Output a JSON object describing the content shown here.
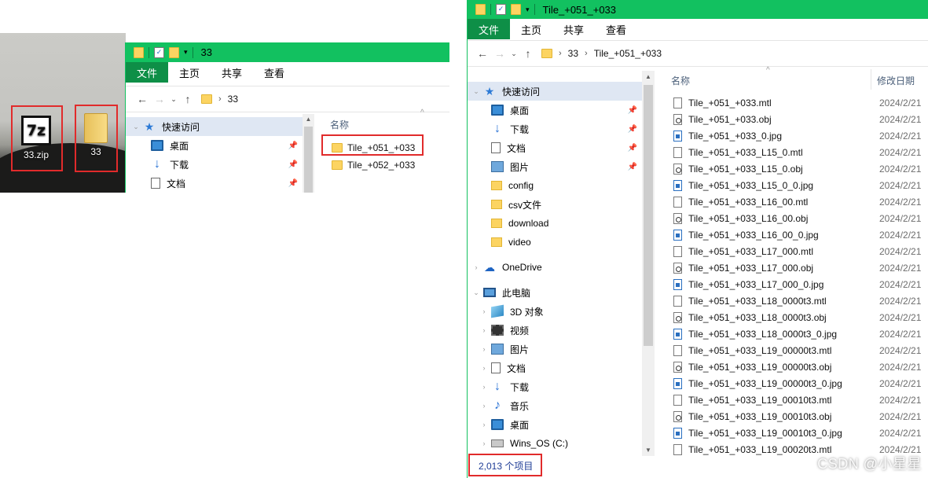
{
  "desktop": {
    "zip_label": "33.zip",
    "zip_icon_text": "7z",
    "folder_label": "33"
  },
  "win1": {
    "title": "33",
    "tabs": [
      "文件",
      "主页",
      "共享",
      "查看"
    ],
    "path": [
      "33"
    ],
    "nav": [
      {
        "label": "快速访问",
        "icon": "star-icon"
      },
      {
        "label": "桌面",
        "icon": "desktop-icon"
      },
      {
        "label": "下载",
        "icon": "download-icon"
      },
      {
        "label": "文档",
        "icon": "document-icon"
      }
    ],
    "column_name": "名称",
    "folders": [
      "Tile_+051_+033",
      "Tile_+052_+033"
    ]
  },
  "win2": {
    "title": "Tile_+051_+033",
    "tabs": [
      "文件",
      "主页",
      "共享",
      "查看"
    ],
    "path": [
      "33",
      "Tile_+051_+033"
    ],
    "nav": [
      {
        "label": "快速访问",
        "icon": "star-icon",
        "pinned": false
      },
      {
        "label": "桌面",
        "icon": "desktop-icon",
        "pinned": true
      },
      {
        "label": "下载",
        "icon": "download-icon",
        "pinned": true
      },
      {
        "label": "文档",
        "icon": "document-icon",
        "pinned": true
      },
      {
        "label": "图片",
        "icon": "picture-icon",
        "pinned": true
      },
      {
        "label": "config",
        "icon": "folder-icon",
        "pinned": false
      },
      {
        "label": "csv文件",
        "icon": "folder-icon",
        "pinned": false
      },
      {
        "label": "download",
        "icon": "folder-icon",
        "pinned": false
      },
      {
        "label": "video",
        "icon": "folder-icon",
        "pinned": false
      },
      {
        "label": "OneDrive",
        "icon": "cloud-icon",
        "pinned": false
      },
      {
        "label": "此电脑",
        "icon": "computer-icon",
        "pinned": false
      },
      {
        "label": "3D 对象",
        "icon": "cube-icon",
        "pinned": false
      },
      {
        "label": "视频",
        "icon": "video-icon",
        "pinned": false
      },
      {
        "label": "图片",
        "icon": "picture-icon",
        "pinned": false
      },
      {
        "label": "文档",
        "icon": "document-icon",
        "pinned": false
      },
      {
        "label": "下载",
        "icon": "download-icon",
        "pinned": false
      },
      {
        "label": "音乐",
        "icon": "music-icon",
        "pinned": false
      },
      {
        "label": "桌面",
        "icon": "desktop-icon",
        "pinned": false
      },
      {
        "label": "Wins_OS (C:)",
        "icon": "drive-icon",
        "pinned": false
      }
    ],
    "columns": {
      "name": "名称",
      "date": "修改日期"
    },
    "files": [
      {
        "name": "Tile_+051_+033.mtl",
        "type": "mtl",
        "date": "2024/2/21"
      },
      {
        "name": "Tile_+051_+033.obj",
        "type": "obj",
        "date": "2024/2/21"
      },
      {
        "name": "Tile_+051_+033_0.jpg",
        "type": "jpg",
        "date": "2024/2/21"
      },
      {
        "name": "Tile_+051_+033_L15_0.mtl",
        "type": "mtl",
        "date": "2024/2/21"
      },
      {
        "name": "Tile_+051_+033_L15_0.obj",
        "type": "obj",
        "date": "2024/2/21"
      },
      {
        "name": "Tile_+051_+033_L15_0_0.jpg",
        "type": "jpg",
        "date": "2024/2/21"
      },
      {
        "name": "Tile_+051_+033_L16_00.mtl",
        "type": "mtl",
        "date": "2024/2/21"
      },
      {
        "name": "Tile_+051_+033_L16_00.obj",
        "type": "obj",
        "date": "2024/2/21"
      },
      {
        "name": "Tile_+051_+033_L16_00_0.jpg",
        "type": "jpg",
        "date": "2024/2/21"
      },
      {
        "name": "Tile_+051_+033_L17_000.mtl",
        "type": "mtl",
        "date": "2024/2/21"
      },
      {
        "name": "Tile_+051_+033_L17_000.obj",
        "type": "obj",
        "date": "2024/2/21"
      },
      {
        "name": "Tile_+051_+033_L17_000_0.jpg",
        "type": "jpg",
        "date": "2024/2/21"
      },
      {
        "name": "Tile_+051_+033_L18_0000t3.mtl",
        "type": "mtl",
        "date": "2024/2/21"
      },
      {
        "name": "Tile_+051_+033_L18_0000t3.obj",
        "type": "obj",
        "date": "2024/2/21"
      },
      {
        "name": "Tile_+051_+033_L18_0000t3_0.jpg",
        "type": "jpg",
        "date": "2024/2/21"
      },
      {
        "name": "Tile_+051_+033_L19_00000t3.mtl",
        "type": "mtl",
        "date": "2024/2/21"
      },
      {
        "name": "Tile_+051_+033_L19_00000t3.obj",
        "type": "obj",
        "date": "2024/2/21"
      },
      {
        "name": "Tile_+051_+033_L19_00000t3_0.jpg",
        "type": "jpg",
        "date": "2024/2/21"
      },
      {
        "name": "Tile_+051_+033_L19_00010t3.mtl",
        "type": "mtl",
        "date": "2024/2/21"
      },
      {
        "name": "Tile_+051_+033_L19_00010t3.obj",
        "type": "obj",
        "date": "2024/2/21"
      },
      {
        "name": "Tile_+051_+033_L19_00010t3_0.jpg",
        "type": "jpg",
        "date": "2024/2/21"
      },
      {
        "name": "Tile_+051_+033_L19_00020t3.mtl",
        "type": "mtl",
        "date": "2024/2/21"
      }
    ],
    "status": "2,013 个项目"
  },
  "watermark": "CSDN @小星星",
  "colors": {
    "titlebar": "#12c160",
    "file_tab": "#0e8f47",
    "highlight": "#e12b2b"
  }
}
